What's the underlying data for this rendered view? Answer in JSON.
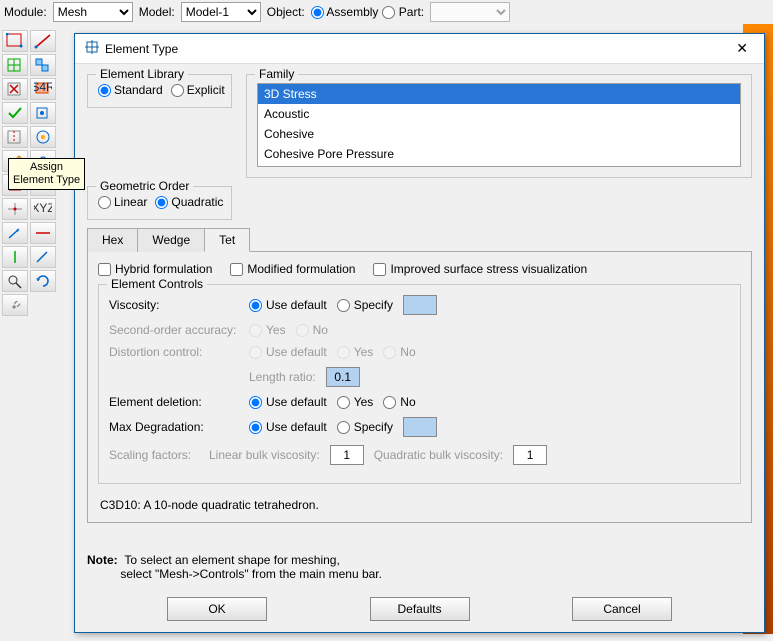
{
  "toolbar": {
    "module_label": "Module:",
    "module_value": "Mesh",
    "model_label": "Model:",
    "model_value": "Model-1",
    "object_label": "Object:",
    "assembly": "Assembly",
    "part": "Part:"
  },
  "tooltip": "Assign\nElement Type",
  "dialog": {
    "title": "Element Type",
    "elem_library": {
      "legend": "Element Library",
      "standard": "Standard",
      "explicit": "Explicit"
    },
    "family": {
      "legend": "Family",
      "items": [
        "3D Stress",
        "Acoustic",
        "Cohesive",
        "Cohesive Pore Pressure"
      ]
    },
    "geo_order": {
      "legend": "Geometric Order",
      "linear": "Linear",
      "quadratic": "Quadratic"
    },
    "tabs": {
      "hex": "Hex",
      "wedge": "Wedge",
      "tet": "Tet"
    },
    "checks": {
      "hybrid": "Hybrid formulation",
      "modified": "Modified formulation",
      "improved": "Improved surface stress visualization"
    },
    "controls": {
      "legend": "Element Controls",
      "viscosity": "Viscosity:",
      "use_default": "Use default",
      "specify": "Specify",
      "second_order": "Second-order accuracy:",
      "yes": "Yes",
      "no": "No",
      "distortion": "Distortion control:",
      "length_ratio": "Length ratio:",
      "length_ratio_val": "0.1",
      "elem_deletion": "Element deletion:",
      "max_degradation": "Max Degradation:",
      "scaling": "Scaling factors:",
      "linear_bulk": "Linear bulk viscosity:",
      "quad_bulk": "Quadratic bulk viscosity:",
      "one": "1"
    },
    "desc": "C3D10:  A 10-node quadratic tetrahedron.",
    "note_label": "Note:",
    "note_line1": "To select an element shape for meshing,",
    "note_line2": "select \"Mesh->Controls\" from the main menu bar.",
    "buttons": {
      "ok": "OK",
      "defaults": "Defaults",
      "cancel": "Cancel"
    }
  }
}
